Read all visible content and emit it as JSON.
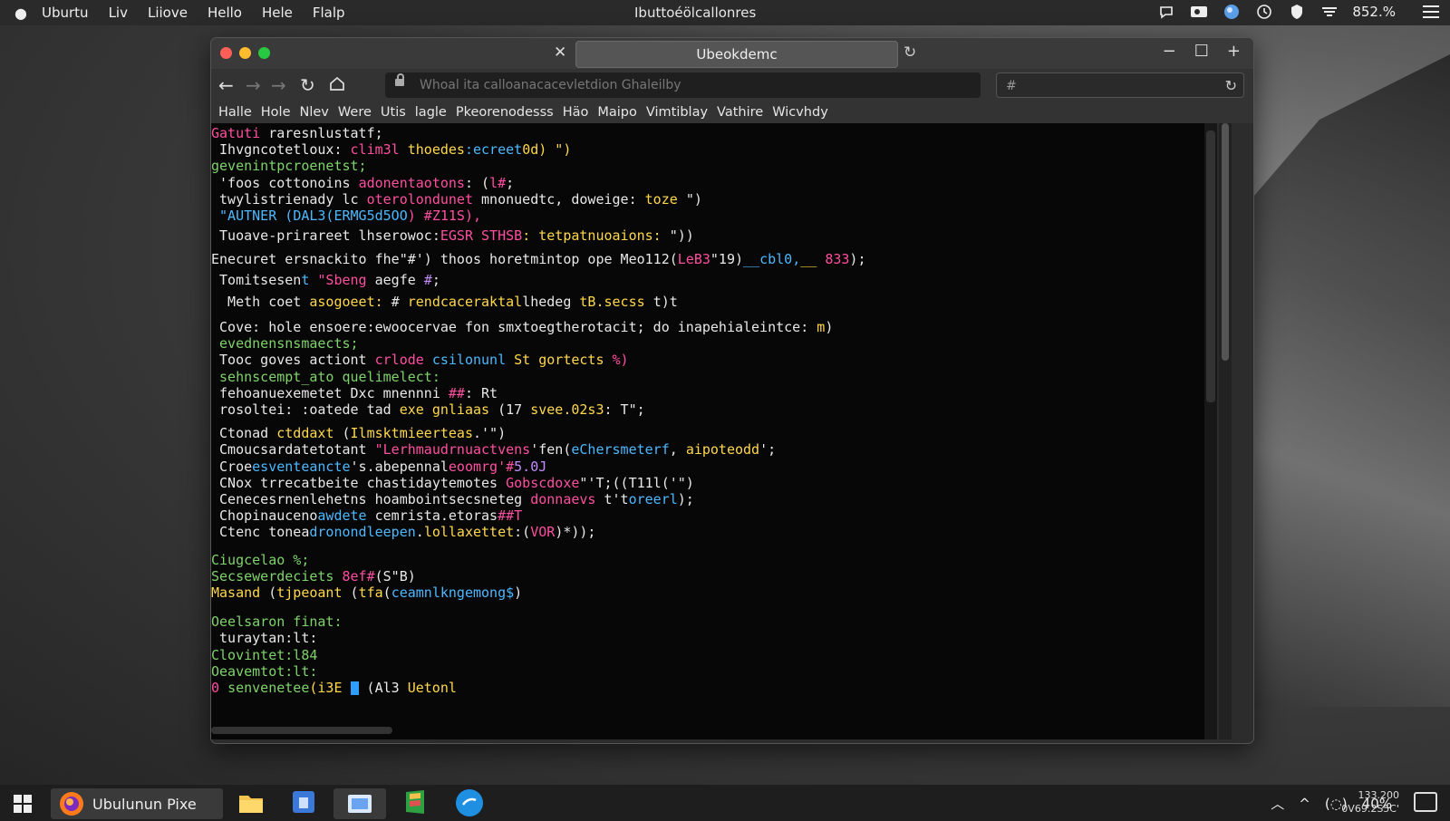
{
  "menubar": {
    "items": [
      "Uburtu",
      "Liv",
      "Liiove",
      "Hello",
      "Hele",
      "Flalp"
    ],
    "center_title": "Ibuttoéölcallonres",
    "battery": "852.%"
  },
  "window": {
    "tab_title": "Ubeokdemc",
    "url": "Whoal ita calloanacacevletdion Ghaleilby",
    "search_text": "#"
  },
  "bookmarks": [
    "Halle",
    "Hole",
    "Nlev",
    "Were",
    "Utis",
    "lagle",
    "Pkeorenodesss",
    "Häo",
    "Maipo",
    "Vimtiblay",
    "Vathire",
    "Wicvhdy"
  ],
  "terminal": {
    "l1a": "Gatuti ",
    "l1b": "raresnlustatf;",
    "l2a": " Ihvgncotetloux: ",
    "l2b": "clim3l ",
    "l2c": "thoedes",
    "l2d": ":ecreet",
    "l2e": "0d) \")",
    "l3": "gevenintpcroenetst;",
    "l4a": " 'foos cottonoins ",
    "l4b": "adonentaotons",
    "l4c": ": (",
    "l4d": "l#",
    "l4e": ";",
    "l5a": " twylistrienady lc ",
    "l5b": "oterolondunet ",
    "l5c": "mnonuedtc, doweige: ",
    "l5d": "toze ",
    "l5e": "\")",
    "l6a": " \"AUTNER (",
    "l6b": "DAL3(ERMG5d5OO",
    "l6c": ") #Z11S),",
    "l7a": " Tuoave-prirareet lhserowoc:",
    "l7b": "EGSR STHSB",
    "l7c": ": tetpatnuoaions: ",
    "l7d": "\"))",
    "l8a": "Enecuret ersnackito fhe\"#') thoos horetmintop ope Meo112(",
    "l8b": "LeB3",
    "l8c": "\"19)",
    "l8d": "__cbl0,",
    "l8e": "__ ",
    "l8f": "833",
    "l8g": ");",
    "l9a": " Tomitsesen",
    "l9b": "t ",
    "l9c": "\"Sbeng ",
    "l9d": "aegfe ",
    "l9e": "#",
    "l9f": ";",
    "l10a": "  Meth coet ",
    "l10b": "asogoeet: ",
    "l10c": "# ",
    "l10d": "rendcaceraktal",
    "l10e": "lhedeg ",
    "l10f": "tB.secss ",
    "l10g": "t)t",
    "l11a": " Cove: hole ensoere:ewoocervae fon smxtoegtherotacit; do inapehialeintce: ",
    "l11b": "m",
    "l11c": ")",
    "l12": " evednensnsmaects;",
    "l13a": " Tooc goves actiont ",
    "l13b": "crlode ",
    "l13c": "csilonunl ",
    "l13d": "St ",
    "l13e": "gortects ",
    "l13f": "%)",
    "l14": " sehnscempt_ato quelimelect:",
    "l15a": " fehoanuexemetet Dxc ",
    "l15b": "mnennni ",
    "l15c": "##",
    "l15d": ": Rt",
    "l16a": " rosoltei: :oatede tad ",
    "l16b": "exe ",
    "l16c": "gnliaas ",
    "l16d": "(17 ",
    "l16e": "svee.02s3",
    "l16f": ": T\";",
    "l17a": " Ctonad ",
    "l17b": "ctddaxt ",
    "l17c": "(",
    "l17d": "Ilmsktmieerteas",
    "l17e": ".'\")",
    "l18a": " Cmoucsardatetotant ",
    "l18b": "\"Lerhmaudrnuactvens",
    "l18c": "'fen(",
    "l18d": "eChersmeterf",
    "l18e": ", ",
    "l18f": "aipoteodd",
    "l18g": "';",
    "l19a": " Croe",
    "l19b": "esventeancte",
    "l19c": "'s.abepennal",
    "l19d": "eoomrg",
    "l19e": "'#",
    "l19f": "5.0J",
    "l20a": " CNox trrecatbeite chastidaytemotes ",
    "l20b": "Gobscdoxe",
    "l20c": "\"'T;((T11l('\")",
    "l21a": " Cenecesrnenlehetns hoambointsecsneteg ",
    "l21b": "donnaevs ",
    "l21c": "t't",
    "l21d": "oreerl",
    "l21e": ");",
    "l22a": " Chopinauceno",
    "l22b": "awdete ",
    "l22c": "cemrista.etoras",
    "l22d": "#",
    "l22e": "#T",
    "l23a": " Ctenc tonea",
    "l23b": "dronondleepen",
    "l23c": ".",
    "l23d": "lollaxettet",
    "l23e": ":(",
    "l23f": "VOR",
    "l23g": ")*));",
    "l24": "Ciugcelao %;",
    "l25a": "Secsewerdeciets ",
    "l25b": "8ef#",
    "l25c": "(S\"B)",
    "l26a": "Masand ",
    "l26b": "(",
    "l26c": "tjpeoant",
    "l26d": " ",
    "l26e": "(",
    "l26f": "tfa",
    "l26g": "(",
    "l26h": "ceamnlkngemong$",
    "l26i": ")",
    "l27": "Oeelsaron finat:",
    "l28": " turaytan:lt:",
    "l29": "Clovintet:l84",
    "l30": "Oeavemtot:lt:",
    "l31a": "0 ",
    "l31b": "senvenetee",
    "l31c": "(i3E ",
    "l31d": " (Al3 ",
    "l31e": "Uetonl"
  },
  "taskbar": {
    "browser_label": "Ubulunun Pixe",
    "pct": "40%",
    "clock_line1": "133.200",
    "clock_line2": "0V69.2S5C'"
  },
  "colors": {
    "green": "#7fd36b",
    "pink": "#ff4fa0",
    "cyan": "#4db8ff",
    "yellow": "#ffd84d",
    "orange": "#ff9a3c",
    "violet": "#c58cff",
    "cursor": "#2f9cff"
  }
}
